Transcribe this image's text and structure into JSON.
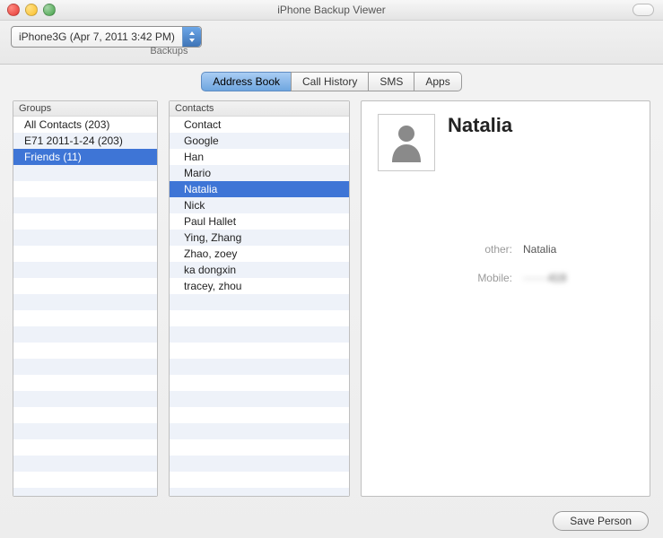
{
  "window": {
    "title": "iPhone Backup Viewer"
  },
  "toolbar": {
    "backup_selected": "iPhone3G (Apr 7, 2011 3:42 PM)",
    "backups_label": "Backups"
  },
  "tabs": [
    {
      "label": "Address Book",
      "active": true
    },
    {
      "label": "Call History",
      "active": false
    },
    {
      "label": "SMS",
      "active": false
    },
    {
      "label": "Apps",
      "active": false
    }
  ],
  "groups": {
    "header": "Groups",
    "items": [
      {
        "label": "All Contacts (203)",
        "selected": false
      },
      {
        "label": "E71 2011-1-24 (203)",
        "selected": false
      },
      {
        "label": "Friends (11)",
        "selected": true
      }
    ]
  },
  "contacts": {
    "header": "Contacts",
    "items": [
      {
        "label": "Contact",
        "selected": false
      },
      {
        "label": "Google",
        "selected": false
      },
      {
        "label": "Han",
        "selected": false
      },
      {
        "label": "Mario",
        "selected": false
      },
      {
        "label": "Natalia",
        "selected": true
      },
      {
        "label": "Nick",
        "selected": false
      },
      {
        "label": "Paul Hallet",
        "selected": false
      },
      {
        "label": "Ying, Zhang",
        "selected": false
      },
      {
        "label": "Zhao, zoey",
        "selected": false
      },
      {
        "label": "ka dongxin",
        "selected": false
      },
      {
        "label": "tracey, zhou",
        "selected": false
      }
    ]
  },
  "detail": {
    "name": "Natalia",
    "fields": [
      {
        "label": "other:",
        "value": "Natalia",
        "blurred": false
      },
      {
        "label": "Mobile:",
        "value": "·······419",
        "blurred": true
      }
    ]
  },
  "footer": {
    "save_button": "Save Person"
  }
}
